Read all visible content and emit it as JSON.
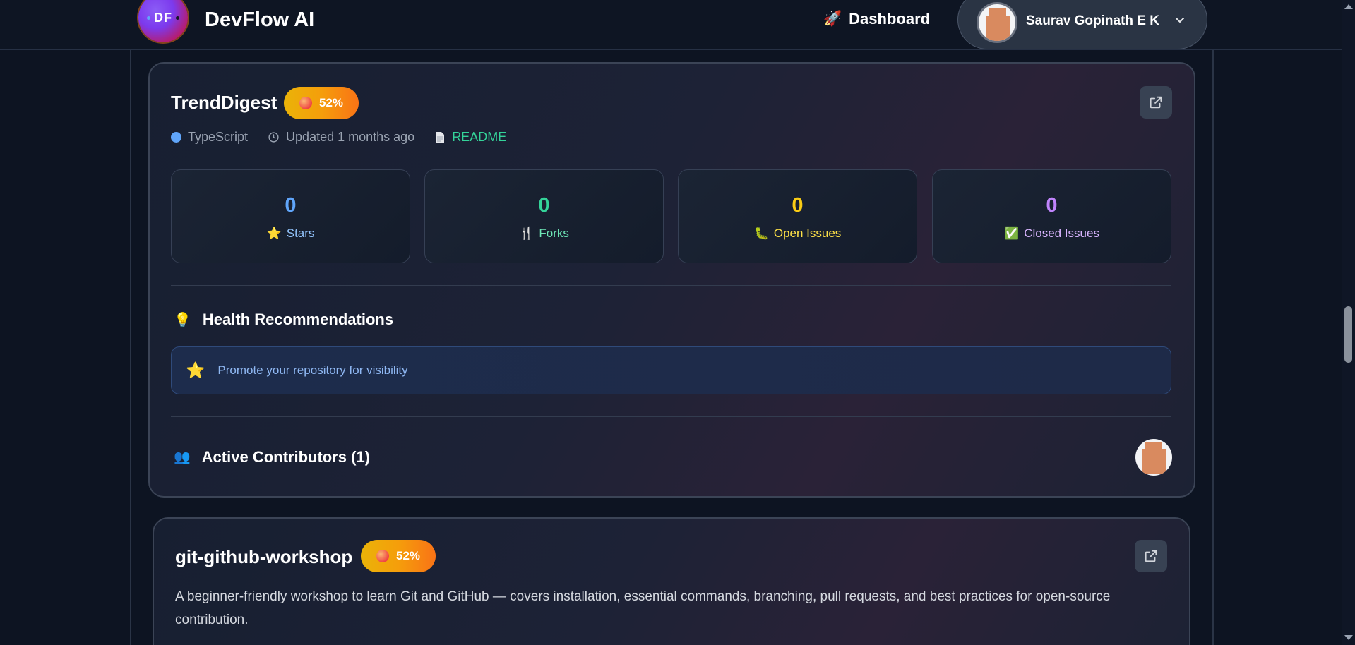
{
  "header": {
    "logo_text": "DF",
    "brand": "DevFlow AI",
    "dashboard_icon": "rocket-icon",
    "dashboard_emoji": "🚀",
    "dashboard_label": "Dashboard",
    "user_name": "Saurav Gopinath E K"
  },
  "repos": [
    {
      "name": "TrendDigest",
      "score": "52%",
      "language": "TypeScript",
      "updated": "Updated 1 months ago",
      "readme": "README",
      "stats": [
        {
          "value": "0",
          "label": "Stars",
          "emoji": "⭐",
          "color": "#60a5fa"
        },
        {
          "value": "0",
          "label": "Forks",
          "emoji": "🍴",
          "color": "#34d399"
        },
        {
          "value": "0",
          "label": "Open Issues",
          "emoji": "🐛",
          "color": "#facc15"
        },
        {
          "value": "0",
          "label": "Closed Issues",
          "emoji": "✅",
          "color": "#c084fc"
        }
      ],
      "recommendations_title": "Health Recommendations",
      "recommendations_emoji": "💡",
      "recommendations": [
        {
          "emoji": "⭐",
          "text": "Promote your repository for visibility"
        }
      ],
      "contributors_title": "Active Contributors (1)",
      "contributors_emoji": "👥"
    },
    {
      "name": "git-github-workshop",
      "score": "52%",
      "description": "A beginner-friendly workshop to learn Git and GitHub — covers installation, essential commands, branching, pull requests, and best practices for open-source contribution."
    }
  ]
}
